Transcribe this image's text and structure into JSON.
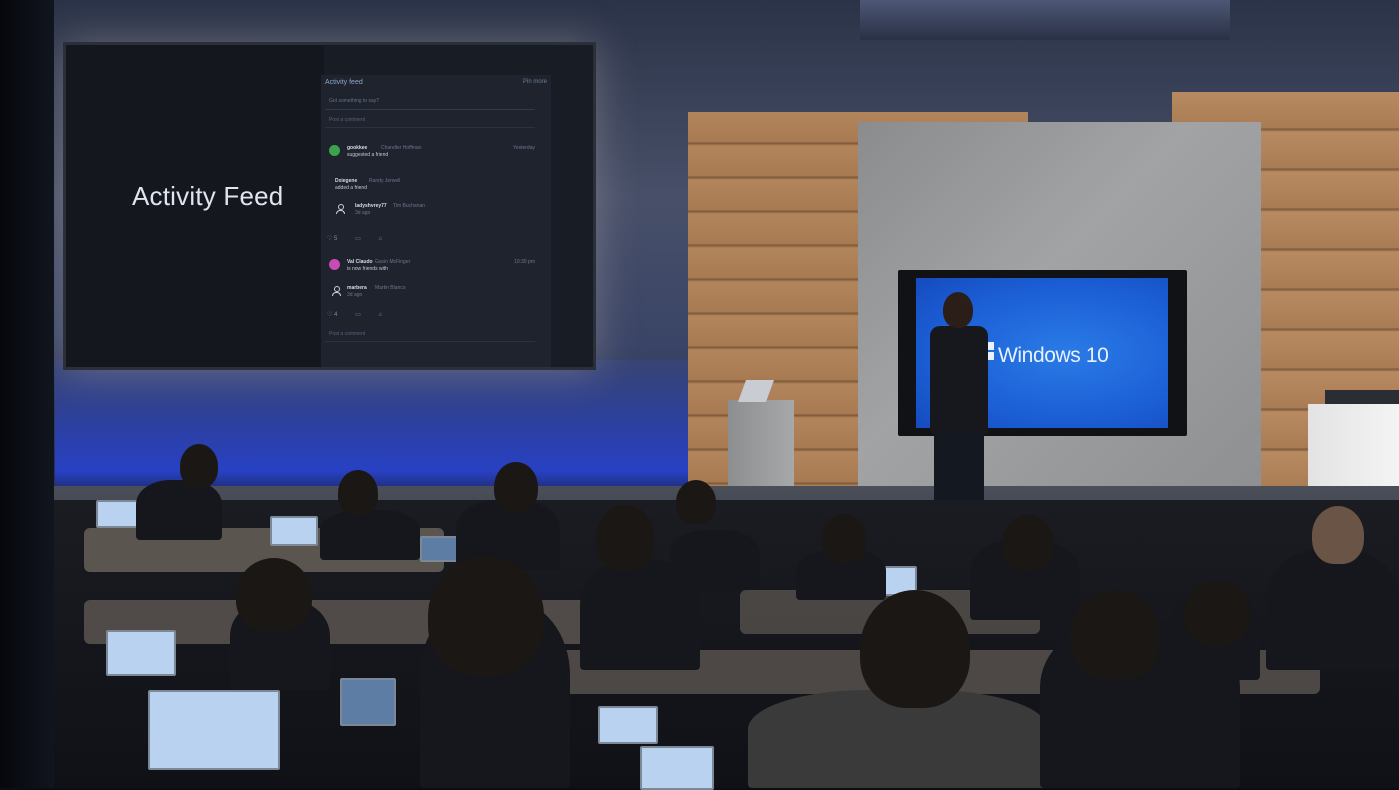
{
  "projection": {
    "title": "Activity Feed",
    "app": {
      "header": "Activity feed",
      "header_right": "Pin more",
      "compose_placeholder": "Got something to say?",
      "compose_secondary": "Post a comment",
      "items": [
        {
          "name": "gookkee",
          "meta_left": "Chandler Hoffman",
          "action": "suggested a friend",
          "time": "Yesterday",
          "avatar_color": "#3ba34a"
        },
        {
          "name": "Dxiegene",
          "meta_left": "Randy Jerwell",
          "action": "added a friend"
        },
        {
          "name": "ladyshvrey77",
          "meta_left": "Tim Buchanan",
          "action": "3d ago"
        },
        {
          "name": "Val Claudo",
          "meta_left": "Gavin McFinger",
          "action": "is now friends with",
          "time": "10:30 pm",
          "avatar_color": "#c64bb4"
        },
        {
          "name": "marbera",
          "meta_left": "Martin Blanco",
          "action": "3d ago"
        }
      ],
      "reaction_rows": [
        {
          "likes": "♡ 5",
          "comment": "▭",
          "share": "⌂"
        },
        {
          "likes": "♡ 4",
          "comment": "▭",
          "share": "⌂"
        }
      ],
      "footer_placeholder": "Post a comment"
    }
  },
  "tv": {
    "logo_icon": "windows-logo",
    "text": "Windows 10"
  }
}
